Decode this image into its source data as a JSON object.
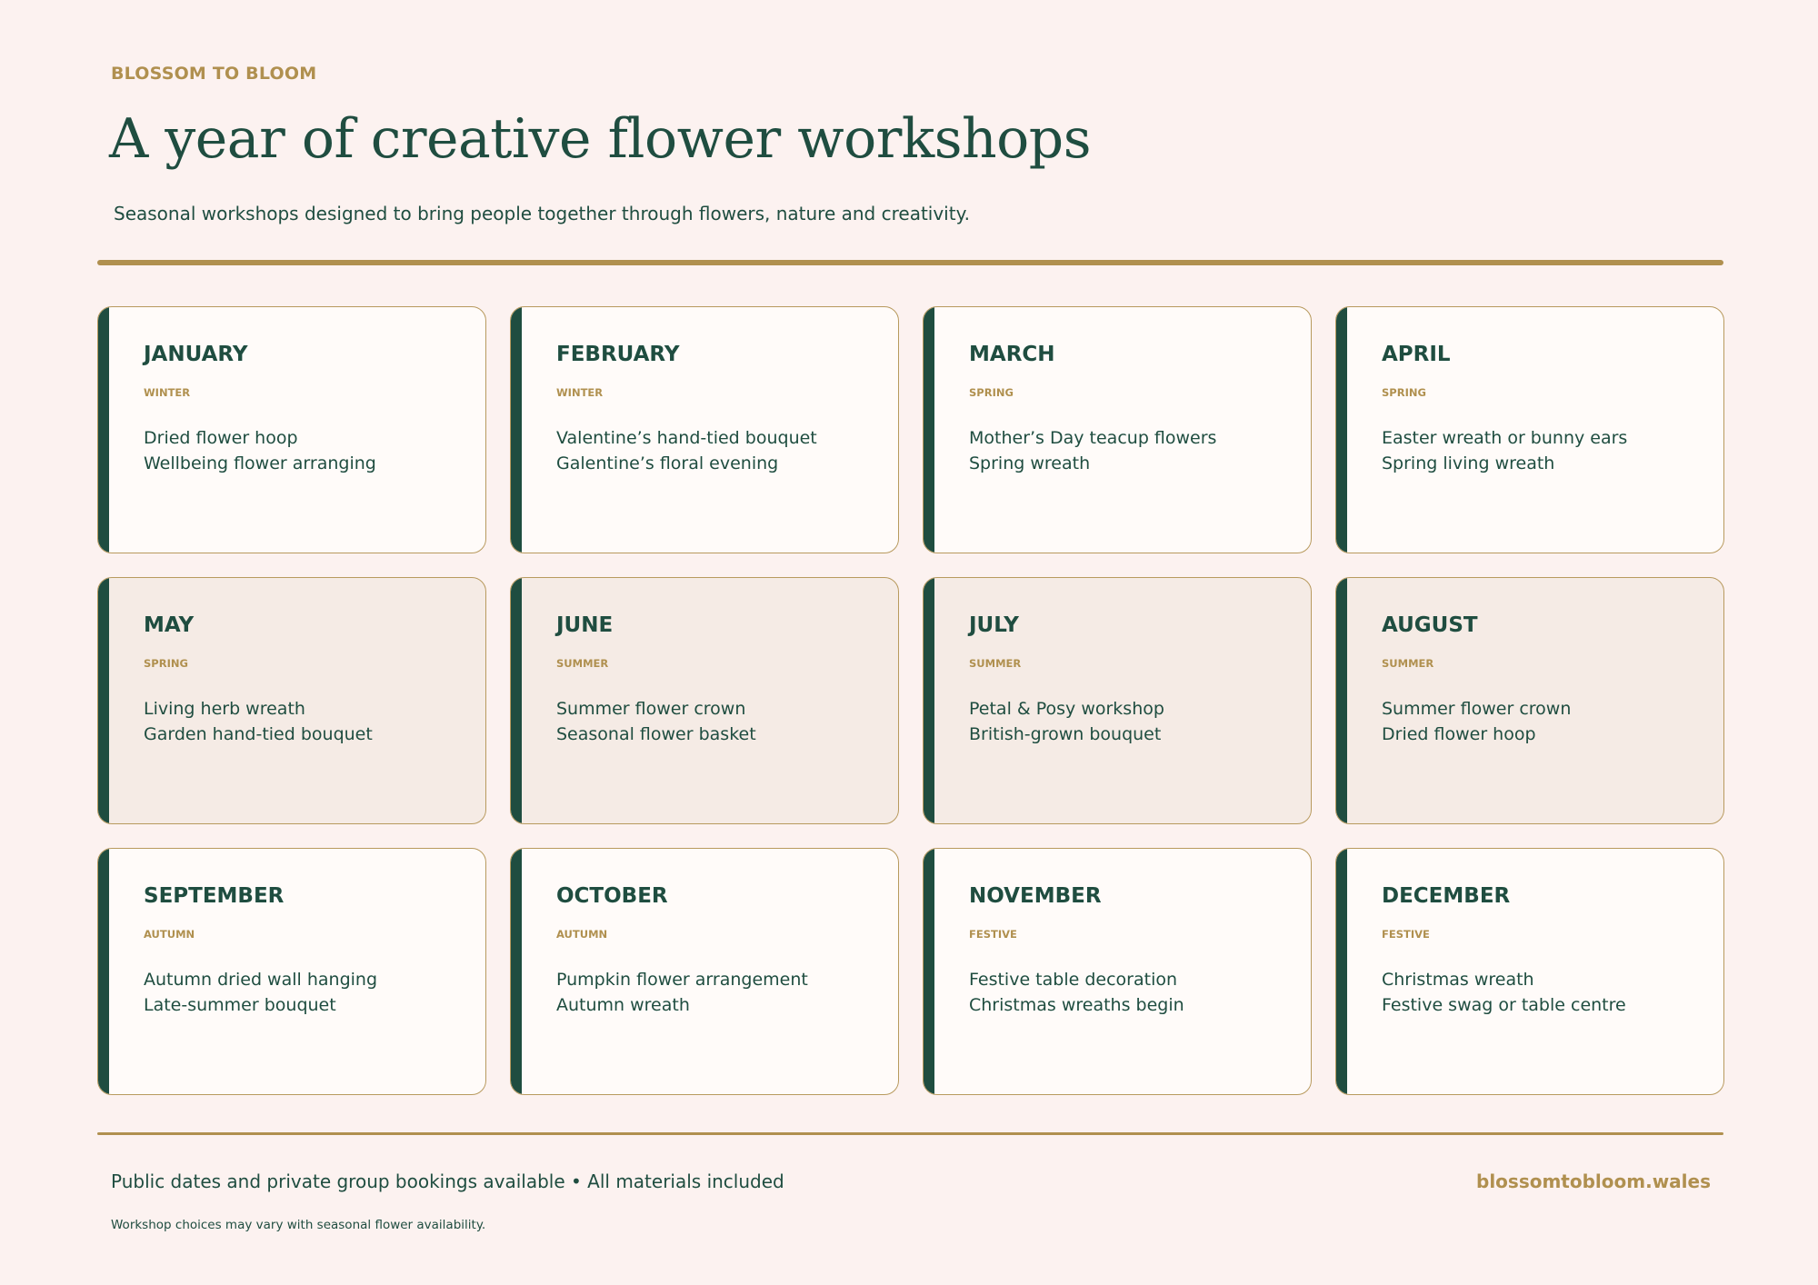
{
  "header": {
    "brand": "BLOSSOM TO BLOOM",
    "title": "A year of creative flower workshops",
    "subtitle": "Seasonal workshops designed to bring people together through flowers, nature and creativity."
  },
  "months": [
    {
      "name": "JANUARY",
      "season": "WINTER",
      "workshops": [
        "Dried flower hoop",
        "Wellbeing flower arranging"
      ]
    },
    {
      "name": "FEBRUARY",
      "season": "WINTER",
      "workshops": [
        "Valentine’s hand-tied bouquet",
        "Galentine’s floral evening"
      ]
    },
    {
      "name": "MARCH",
      "season": "SPRING",
      "workshops": [
        "Mother’s Day teacup flowers",
        "Spring wreath"
      ]
    },
    {
      "name": "APRIL",
      "season": "SPRING",
      "workshops": [
        "Easter wreath or bunny ears",
        "Spring living wreath"
      ]
    },
    {
      "name": "MAY",
      "season": "SPRING",
      "workshops": [
        "Living herb wreath",
        "Garden hand-tied bouquet"
      ]
    },
    {
      "name": "JUNE",
      "season": "SUMMER",
      "workshops": [
        "Summer flower crown",
        "Seasonal flower basket"
      ]
    },
    {
      "name": "JULY",
      "season": "SUMMER",
      "workshops": [
        "Petal & Posy workshop",
        "British-grown bouquet"
      ]
    },
    {
      "name": "AUGUST",
      "season": "SUMMER",
      "workshops": [
        "Summer flower crown",
        "Dried flower hoop"
      ]
    },
    {
      "name": "SEPTEMBER",
      "season": "AUTUMN",
      "workshops": [
        "Autumn dried wall hanging",
        "Late-summer bouquet"
      ]
    },
    {
      "name": "OCTOBER",
      "season": "AUTUMN",
      "workshops": [
        "Pumpkin flower arrangement",
        "Autumn wreath"
      ]
    },
    {
      "name": "NOVEMBER",
      "season": "FESTIVE",
      "workshops": [
        "Festive table decoration",
        "Christmas wreaths begin"
      ]
    },
    {
      "name": "DECEMBER",
      "season": "FESTIVE",
      "workshops": [
        "Christmas wreath",
        "Festive swag or table centre"
      ]
    }
  ],
  "footer": {
    "line": "Public dates and private group bookings available • All materials included",
    "url": "blossomtobloom.wales",
    "note": "Workshop choices may vary with seasonal flower availability."
  },
  "colors": {
    "background": "#fcf2f0",
    "accent_gold": "#b0904f",
    "primary_green": "#1f4d40",
    "card_light": "#fffbf9",
    "card_tinted": "#f5ebe5"
  }
}
